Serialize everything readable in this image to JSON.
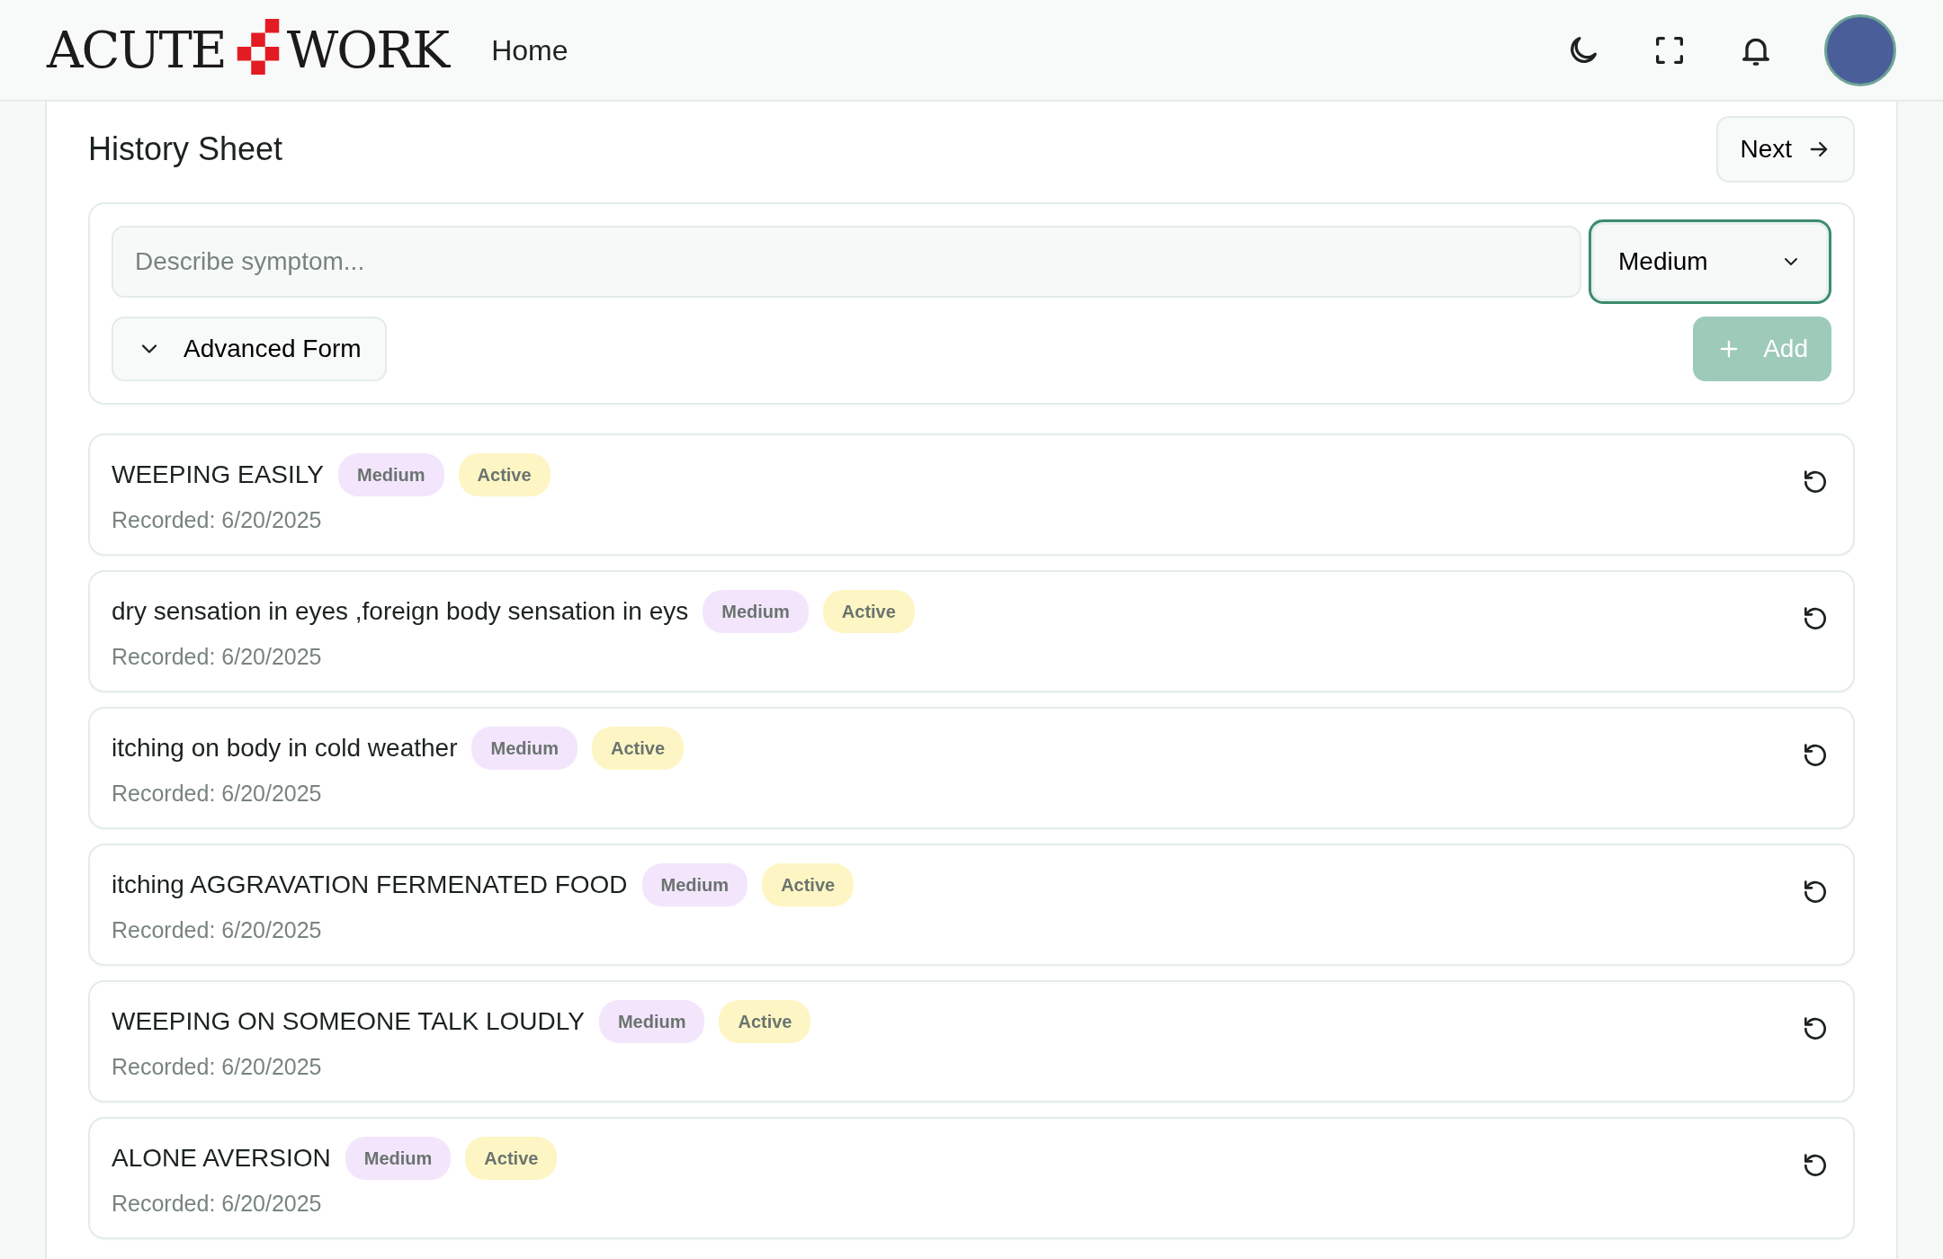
{
  "header": {
    "logo": {
      "left": "ACUTE",
      "right": "WORK"
    },
    "nav": [
      {
        "label": "Home"
      }
    ]
  },
  "page": {
    "title": "History Sheet",
    "next_button": "Next"
  },
  "form": {
    "symptom": {
      "placeholder": "Describe symptom..."
    },
    "severity": {
      "value": "Medium",
      "focused": true
    },
    "advanced_toggle": {
      "label": "Advanced Form",
      "expanded": false
    },
    "add_button": {
      "label": "Add",
      "disabled": true
    }
  },
  "symptoms": [
    {
      "name": "WEEPING EASILY",
      "severity": "Medium",
      "status": "Active",
      "recorded": "Recorded: 6/20/2025"
    },
    {
      "name": "dry sensation in eyes ,foreign body sensation in eys",
      "severity": "Medium",
      "status": "Active",
      "recorded": "Recorded: 6/20/2025"
    },
    {
      "name": "itching on body in cold weather",
      "severity": "Medium",
      "status": "Active",
      "recorded": "Recorded: 6/20/2025"
    },
    {
      "name": "itching AGGRAVATION FERMENATED FOOD",
      "severity": "Medium",
      "status": "Active",
      "recorded": "Recorded: 6/20/2025"
    },
    {
      "name": "WEEPING ON SOMEONE TALK LOUDLY",
      "severity": "Medium",
      "status": "Active",
      "recorded": "Recorded: 6/20/2025"
    },
    {
      "name": "ALONE AVERSION",
      "severity": "Medium",
      "status": "Active",
      "recorded": "Recorded: 6/20/2025"
    }
  ]
}
